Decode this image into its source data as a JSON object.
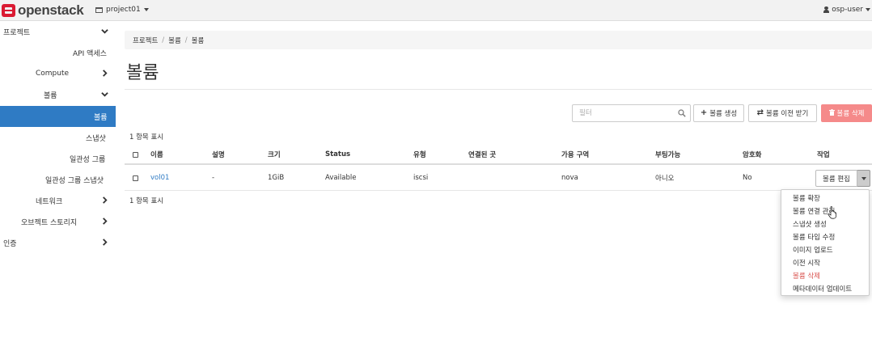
{
  "navbar": {
    "brand": "openstack",
    "project": "project01",
    "user": "osp-user"
  },
  "sidebar": {
    "items": [
      {
        "label": "프로젝트",
        "level": 0,
        "expanded": true
      },
      {
        "label": "API 액세스",
        "level": 1
      },
      {
        "label": "Compute",
        "level": 1
      },
      {
        "label": "볼륨",
        "level": 1,
        "expanded": true
      },
      {
        "label": "볼륨",
        "level": 2,
        "active": true
      },
      {
        "label": "스냅샷",
        "level": 2
      },
      {
        "label": "일관성 그룹",
        "level": 2
      },
      {
        "label": "일관성 그룹 스냅샷",
        "level": 2
      },
      {
        "label": "네트워크",
        "level": 1
      },
      {
        "label": "오브젝트 스토리지",
        "level": 1
      },
      {
        "label": "인증",
        "level": 0
      }
    ],
    "active_color": "#2f7bc4"
  },
  "breadcrumb": [
    "프로젝트",
    "볼륨",
    "볼륨"
  ],
  "page_title": "볼륨",
  "toolbar": {
    "filter_placeholder": "필터",
    "create_label": "볼륨 생성",
    "transfer_label": "볼륨 이전 받기",
    "delete_label": "볼륨 삭제"
  },
  "count_top": "1 항목 표시",
  "count_bottom": "1 항목 표시",
  "table": {
    "headers": [
      "이름",
      "설명",
      "크기",
      "Status",
      "유형",
      "연결된 곳",
      "가용 구역",
      "부팅가능",
      "암호화",
      "작업"
    ],
    "rows": [
      {
        "name": "vol01",
        "description": "-",
        "size": "1GiB",
        "status": "Available",
        "type": "iscsi",
        "attached": "",
        "zone": "nova",
        "bootable": "아니오",
        "encrypted": "No",
        "action": "볼륨 편집"
      }
    ]
  },
  "action_menu": {
    "items": [
      {
        "label": "볼륨 확장"
      },
      {
        "label": "볼륨 연결 관리"
      },
      {
        "label": "스냅샷 생성"
      },
      {
        "label": "볼륨 타입 수정"
      },
      {
        "label": "이미지 업로드"
      },
      {
        "label": "이전 시작"
      },
      {
        "label": "볼륨 삭제",
        "danger": true
      },
      {
        "label": "메타데이터 업데이트"
      }
    ]
  },
  "colors": {
    "primary": "#2f7bc4",
    "danger": "#f58a8a",
    "logo": "#da1a32"
  }
}
